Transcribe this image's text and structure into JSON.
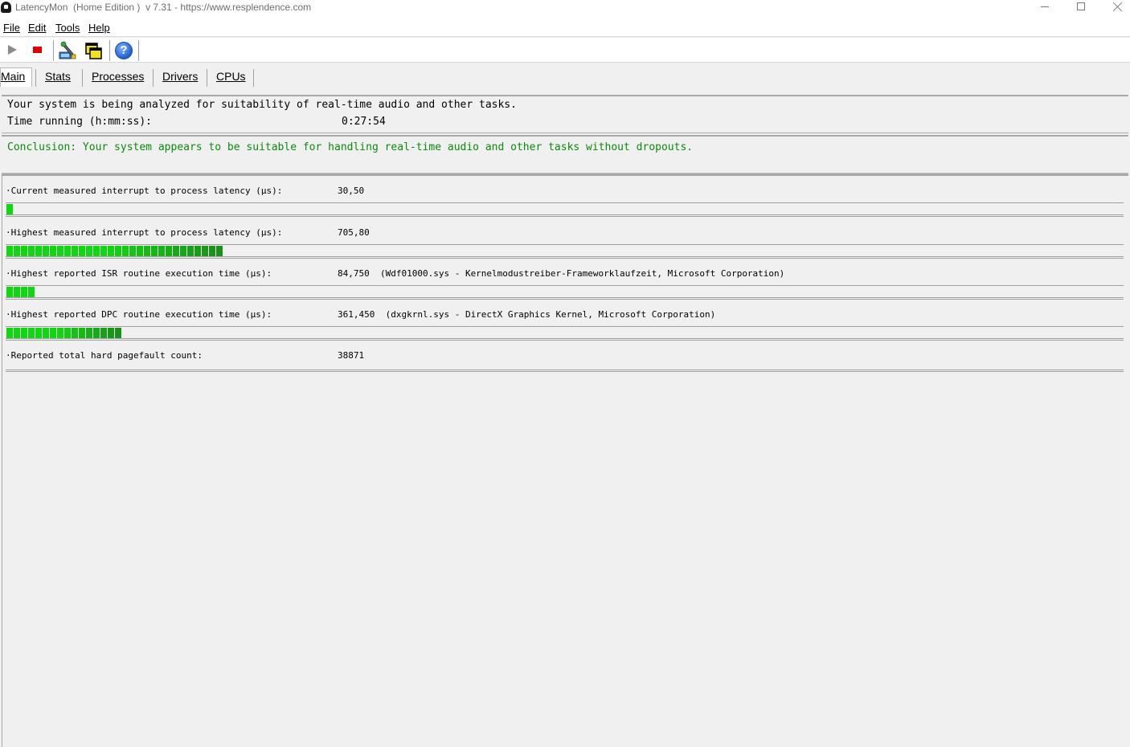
{
  "window": {
    "title": "LatencyMon  (Home Edition )  v 7.31 - https://www.resplendence.com"
  },
  "menu": [
    {
      "label": "File"
    },
    {
      "label": "Edit"
    },
    {
      "label": "Tools"
    },
    {
      "label": "Help"
    }
  ],
  "toolbar": {
    "icons": [
      "play-icon",
      "stop-icon",
      "wrench-tool-icon",
      "windows-icon",
      "help-icon"
    ],
    "help_glyph": "?"
  },
  "tabs": [
    {
      "label": "Main",
      "active": true
    },
    {
      "label": "Stats"
    },
    {
      "label": "Processes"
    },
    {
      "label": "Drivers"
    },
    {
      "label": "CPUs"
    }
  ],
  "status": {
    "analysis_text": "Your system is being analyzed for suitability of real-time audio and other tasks.",
    "time_label": "Time running (h:mm:ss):",
    "time_value": "0:27:54"
  },
  "conclusion": {
    "text": "Conclusion: Your system appears to be suitable for handling real-time audio and other tasks without dropouts.",
    "color": "#0a8a0a"
  },
  "metrics": [
    {
      "label": "·Current measured interrupt to process latency (µs):",
      "value": "30,50",
      "level_fraction": 0.01
    },
    {
      "label": "·Highest measured interrupt to process latency (µs):",
      "value": "705,80",
      "level_fraction": 0.2
    },
    {
      "label": "·Highest reported ISR routine execution time (µs):",
      "value": "84,750  (Wdf01000.sys - Kernelmodustreiber-Frameworklaufzeit, Microsoft Corporation)",
      "level_fraction": 0.025
    },
    {
      "label": "·Highest reported DPC routine execution time (µs):",
      "value": "361,450  (dxgkrnl.sys - DirectX Graphics Kernel, Microsoft Corporation)",
      "level_fraction": 0.1
    },
    {
      "label": "·Reported total hard pagefault count:",
      "value": "38871",
      "level_fraction": 0
    }
  ],
  "colors": {
    "bar_green": "#10d810",
    "bar_dark_green": "#1a8f1a",
    "stop_red": "#e00000"
  }
}
